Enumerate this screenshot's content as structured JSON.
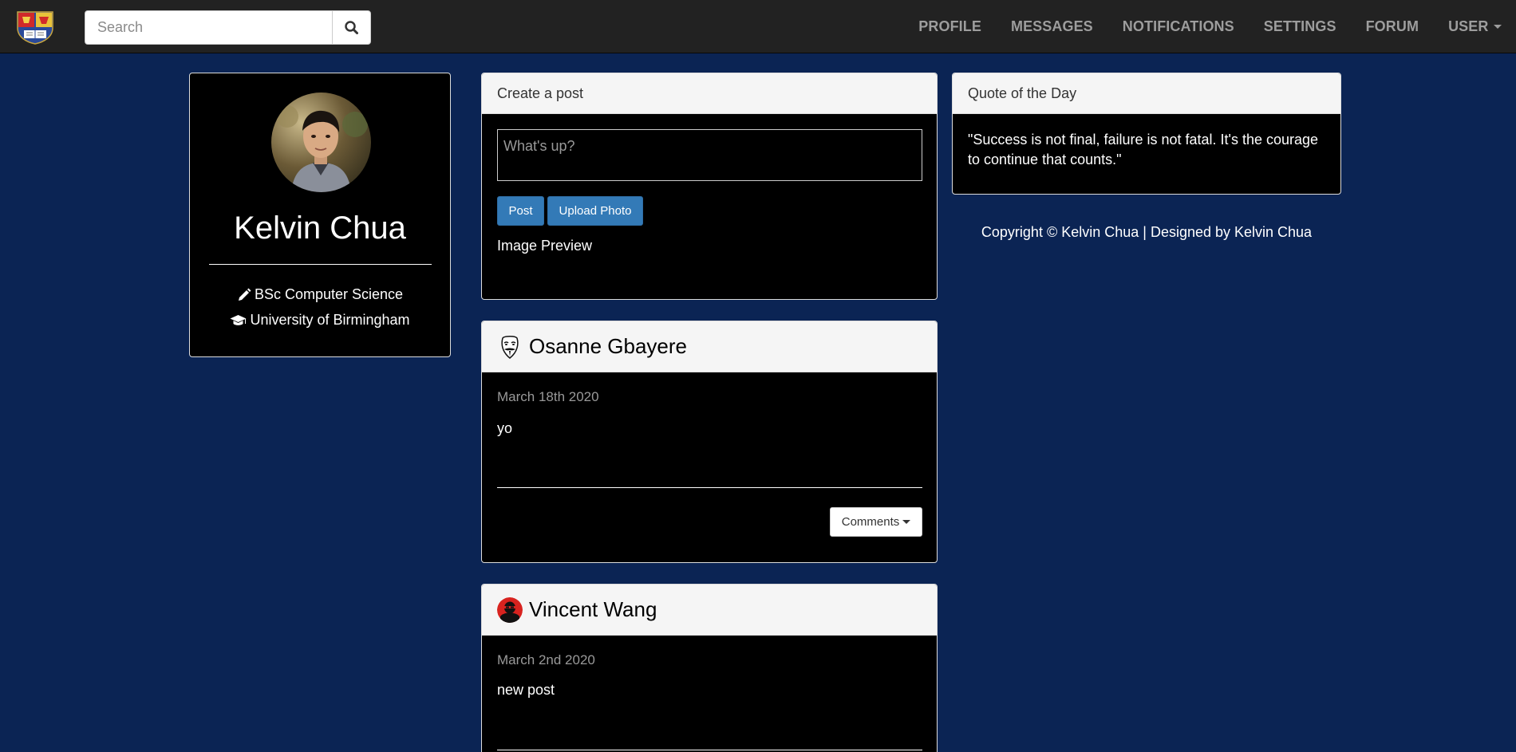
{
  "navbar": {
    "logo_icon": "university-crest-icon",
    "search": {
      "placeholder": "Search",
      "value": ""
    },
    "links": [
      "PROFILE",
      "MESSAGES",
      "NOTIFICATIONS",
      "SETTINGS",
      "FORUM"
    ],
    "user_menu_label": "USER"
  },
  "profile": {
    "name": "Kelvin Chua",
    "degree": "BSc Computer Science",
    "degree_icon": "pencil-icon",
    "university": "University of Birmingham",
    "university_icon": "graduation-cap-icon"
  },
  "create_post": {
    "title": "Create a post",
    "placeholder": "What's up?",
    "post_button": "Post",
    "upload_button": "Upload Photo",
    "image_preview_label": "Image Preview"
  },
  "posts": [
    {
      "author": "Osanne Gbayere",
      "avatar_icon": "guy-fawkes-mask-icon",
      "date": "March 18th 2020",
      "text": "yo",
      "comments_button": "Comments"
    },
    {
      "author": "Vincent Wang",
      "avatar_icon": "red-avatar-icon",
      "date": "March 2nd 2020",
      "text": "new post"
    }
  ],
  "quote": {
    "title": "Quote of the Day",
    "text": "\"Success is not final, failure is not fatal. It's the courage to continue that counts.\""
  },
  "footer": {
    "copyright": "Copyright © Kelvin Chua | Designed by Kelvin Chua"
  },
  "colors": {
    "page_background": "#0b2454",
    "navbar_background": "#222222",
    "primary_button": "#337ab7"
  }
}
